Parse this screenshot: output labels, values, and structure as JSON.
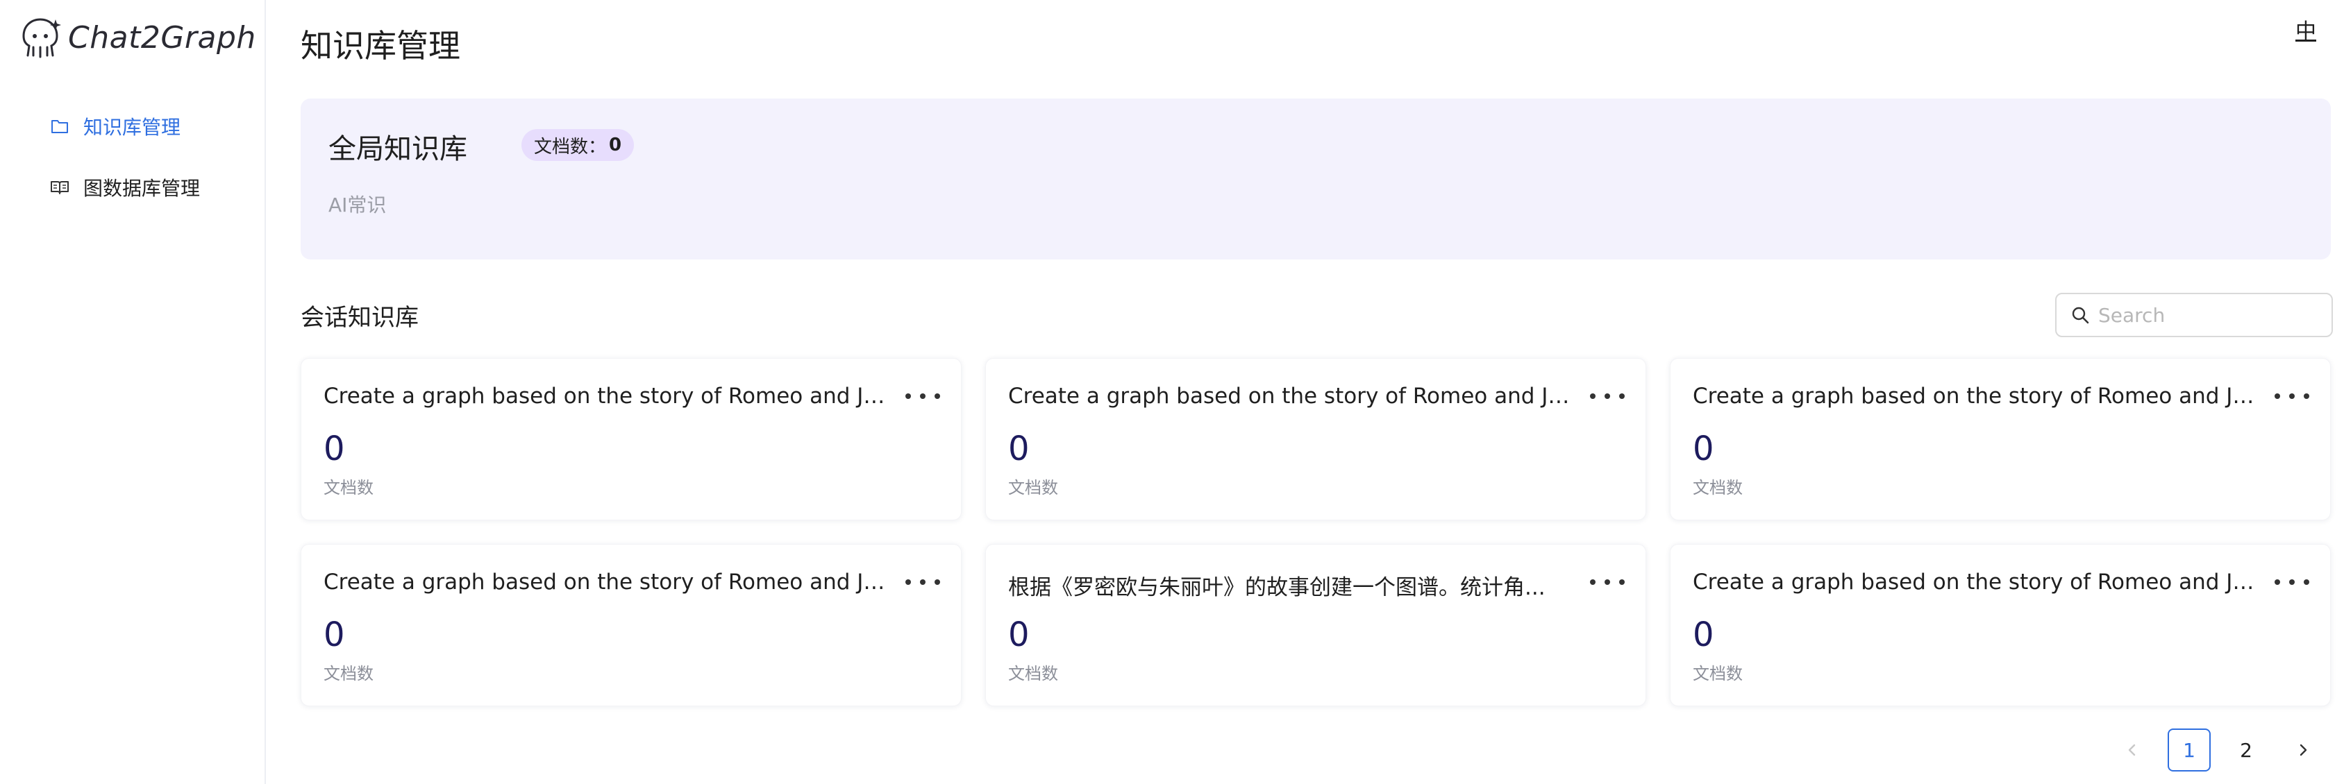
{
  "app": {
    "name": "Chat2Graph",
    "lang_toggle": "中"
  },
  "sidebar": {
    "items": [
      {
        "label": "知识库管理",
        "icon": "folder-icon",
        "active": true
      },
      {
        "label": "图数据库管理",
        "icon": "book-icon",
        "active": false
      }
    ]
  },
  "main": {
    "title": "知识库管理",
    "global": {
      "title": "全局知识库",
      "badge_label": "文档数：",
      "badge_count": "0",
      "description": "AI常识"
    },
    "session": {
      "title": "会话知识库",
      "search_placeholder": "Search"
    },
    "cards": [
      {
        "title": "Create a graph based on the story of Romeo and Juliet...",
        "count": "0",
        "count_label": "文档数"
      },
      {
        "title": "Create a graph based on the story of Romeo and Juliet...",
        "count": "0",
        "count_label": "文档数"
      },
      {
        "title": "Create a graph based on the story of Romeo and Juliet...",
        "count": "0",
        "count_label": "文档数"
      },
      {
        "title": "Create a graph based on the story of Romeo and Juliet...",
        "count": "0",
        "count_label": "文档数"
      },
      {
        "title": "根据《罗密欧与朱丽叶》的故事创建一个图谱。统计角...",
        "count": "0",
        "count_label": "文档数"
      },
      {
        "title": "Create a graph based on the story of Romeo and Juliet...",
        "count": "0",
        "count_label": "文档数"
      }
    ],
    "pagination": {
      "pages": [
        "1",
        "2"
      ],
      "current": "1"
    }
  },
  "colors": {
    "accent": "#2f6fe0",
    "global_card_bg": "#f3f2fd",
    "badge_bg": "#e7ddfd",
    "count_color": "#1d1b5e"
  }
}
